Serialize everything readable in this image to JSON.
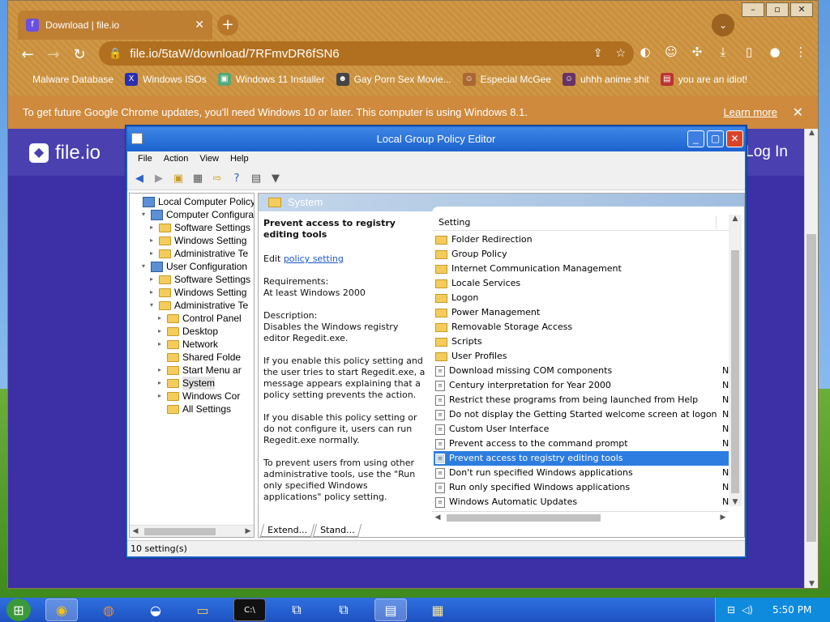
{
  "browser": {
    "tab_title": "Download | file.io",
    "url": "file.io/5taW/download/7RFmvDR6fSN6",
    "bookmarks": [
      {
        "label": "Malware Database"
      },
      {
        "label": "Windows ISOs"
      },
      {
        "label": "Windows 11 Installer"
      },
      {
        "label": "Gay Porn Sex Movie..."
      },
      {
        "label": "Especial McGee"
      },
      {
        "label": "uhhh anime shit"
      },
      {
        "label": "you are an idiot!"
      }
    ],
    "infobar": {
      "message": "To get future Google Chrome updates, you'll need Windows 10 or later. This computer is using Windows 8.1.",
      "learn_more": "Learn more"
    }
  },
  "site": {
    "logo_text": "file.io",
    "login": "Log In"
  },
  "gpe": {
    "title": "Local Group Policy Editor",
    "menu": [
      "File",
      "Action",
      "View",
      "Help"
    ],
    "tree": [
      {
        "label": "Local Computer Policy",
        "indent": 0,
        "icon": "pc",
        "exp": ""
      },
      {
        "label": "Computer Configurati",
        "indent": 1,
        "icon": "pc",
        "exp": "▾"
      },
      {
        "label": "Software Settings",
        "indent": 2,
        "icon": "folder",
        "exp": "▸"
      },
      {
        "label": "Windows Setting",
        "indent": 2,
        "icon": "folder",
        "exp": "▸"
      },
      {
        "label": "Administrative Te",
        "indent": 2,
        "icon": "folder",
        "exp": "▸"
      },
      {
        "label": "User Configuration",
        "indent": 1,
        "icon": "pc",
        "exp": "▾"
      },
      {
        "label": "Software Settings",
        "indent": 2,
        "icon": "folder",
        "exp": "▸"
      },
      {
        "label": "Windows Setting",
        "indent": 2,
        "icon": "folder",
        "exp": "▸"
      },
      {
        "label": "Administrative Te",
        "indent": 2,
        "icon": "folder",
        "exp": "▾"
      },
      {
        "label": "Control Panel",
        "indent": 3,
        "icon": "folder",
        "exp": "▸"
      },
      {
        "label": "Desktop",
        "indent": 3,
        "icon": "folder",
        "exp": "▸"
      },
      {
        "label": "Network",
        "indent": 3,
        "icon": "folder",
        "exp": "▸"
      },
      {
        "label": "Shared Folde",
        "indent": 3,
        "icon": "folder",
        "exp": ""
      },
      {
        "label": "Start Menu ar",
        "indent": 3,
        "icon": "folder",
        "exp": "▸"
      },
      {
        "label": "System",
        "indent": 3,
        "icon": "folder",
        "exp": "▸",
        "selected": true
      },
      {
        "label": "Windows Cor",
        "indent": 3,
        "icon": "folder",
        "exp": "▸"
      },
      {
        "label": "All Settings",
        "indent": 3,
        "icon": "folder",
        "exp": ""
      }
    ],
    "pane_header": "System",
    "description": {
      "heading": "Prevent access to registry editing tools",
      "edit_prefix": "Edit ",
      "edit_link": "policy setting",
      "requirements_label": "Requirements:",
      "requirements": "At least Windows 2000",
      "description_label": "Description:",
      "description": "Disables the Windows registry editor Regedit.exe.",
      "p1": "If you enable this policy setting and the user tries to start Regedit.exe, a message appears explaining that a policy setting prevents the action.",
      "p2": "If you disable this policy setting or do not configure it, users can run Regedit.exe normally.",
      "p3": "To prevent users from using other administrative tools, use the \"Run only specified Windows applications\" policy setting."
    },
    "column_header": "Setting",
    "settings": [
      {
        "name": "Folder Redirection",
        "type": "folder",
        "state": ""
      },
      {
        "name": "Group Policy",
        "type": "folder",
        "state": ""
      },
      {
        "name": "Internet Communication Management",
        "type": "folder",
        "state": ""
      },
      {
        "name": "Locale Services",
        "type": "folder",
        "state": ""
      },
      {
        "name": "Logon",
        "type": "folder",
        "state": ""
      },
      {
        "name": "Power Management",
        "type": "folder",
        "state": ""
      },
      {
        "name": "Removable Storage Access",
        "type": "folder",
        "state": ""
      },
      {
        "name": "Scripts",
        "type": "folder",
        "state": ""
      },
      {
        "name": "User Profiles",
        "type": "folder",
        "state": ""
      },
      {
        "name": "Download missing COM components",
        "type": "policy",
        "state": "N"
      },
      {
        "name": "Century interpretation for Year 2000",
        "type": "policy",
        "state": "N"
      },
      {
        "name": "Restrict these programs from being launched from Help",
        "type": "policy",
        "state": "N"
      },
      {
        "name": "Do not display the Getting Started welcome screen at logon",
        "type": "policy",
        "state": "N"
      },
      {
        "name": "Custom User Interface",
        "type": "policy",
        "state": "N"
      },
      {
        "name": "Prevent access to the command prompt",
        "type": "policy",
        "state": "N"
      },
      {
        "name": "Prevent access to registry editing tools",
        "type": "policy",
        "state": "",
        "selected": true
      },
      {
        "name": "Don't run specified Windows applications",
        "type": "policy",
        "state": "N"
      },
      {
        "name": "Run only specified Windows applications",
        "type": "policy",
        "state": "N"
      },
      {
        "name": "Windows Automatic Updates",
        "type": "policy",
        "state": "N"
      }
    ],
    "tabs": [
      "Extend...",
      "Stand..."
    ],
    "status": "10 setting(s)"
  },
  "taskbar": {
    "clock": "5:50 PM"
  },
  "colors": {
    "accent": "#1c62cf",
    "selection": "#2d7de0",
    "chrome_theme": "#cd9444",
    "site_bg": "#3d2fa5"
  }
}
